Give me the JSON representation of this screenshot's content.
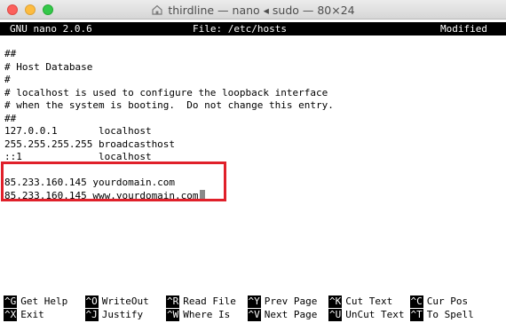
{
  "window": {
    "title": "thirdline — nano ◂ sudo — 80×24",
    "title_icon": "home-folder-icon"
  },
  "nano": {
    "header_left": "GNU nano 2.0.6",
    "header_center": "File: /etc/hosts",
    "header_right": "Modified"
  },
  "buffer_lines": [
    "##",
    "# Host Database",
    "#",
    "# localhost is used to configure the loopback interface",
    "# when the system is booting.  Do not change this entry.",
    "##",
    "127.0.0.1       localhost",
    "255.255.255.255 broadcasthost",
    "::1             localhost",
    "",
    "85.233.160.145 yourdomain.com",
    "85.233.160.145 www.yourdomain.com"
  ],
  "highlight_color": "#e0202a",
  "shortcuts": [
    {
      "key": "^G",
      "label": "Get Help"
    },
    {
      "key": "^O",
      "label": "WriteOut"
    },
    {
      "key": "^R",
      "label": "Read File"
    },
    {
      "key": "^Y",
      "label": "Prev Page"
    },
    {
      "key": "^K",
      "label": "Cut Text"
    },
    {
      "key": "^C",
      "label": "Cur Pos"
    },
    {
      "key": "^X",
      "label": "Exit"
    },
    {
      "key": "^J",
      "label": "Justify"
    },
    {
      "key": "^W",
      "label": "Where Is"
    },
    {
      "key": "^V",
      "label": "Next Page"
    },
    {
      "key": "^U",
      "label": "UnCut Text"
    },
    {
      "key": "^T",
      "label": "To Spell"
    }
  ]
}
